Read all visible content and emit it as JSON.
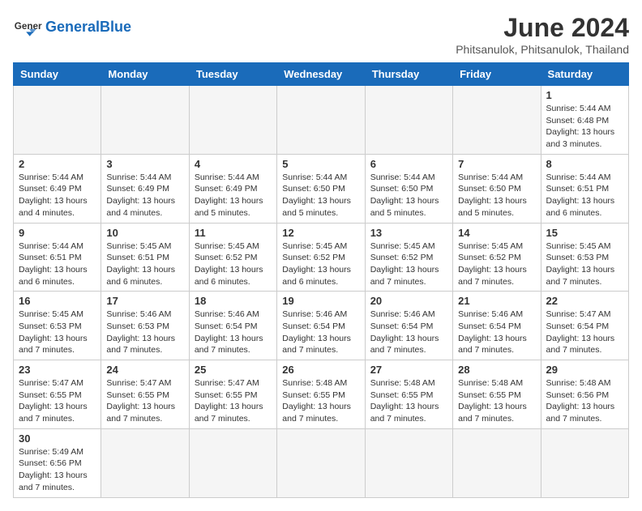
{
  "header": {
    "logo_general": "General",
    "logo_blue": "Blue",
    "month_title": "June 2024",
    "subtitle": "Phitsanulok, Phitsanulok, Thailand"
  },
  "days_of_week": [
    "Sunday",
    "Monday",
    "Tuesday",
    "Wednesday",
    "Thursday",
    "Friday",
    "Saturday"
  ],
  "weeks": [
    [
      {
        "day": "",
        "info": ""
      },
      {
        "day": "",
        "info": ""
      },
      {
        "day": "",
        "info": ""
      },
      {
        "day": "",
        "info": ""
      },
      {
        "day": "",
        "info": ""
      },
      {
        "day": "",
        "info": ""
      },
      {
        "day": "1",
        "info": "Sunrise: 5:44 AM\nSunset: 6:48 PM\nDaylight: 13 hours and 3 minutes."
      }
    ],
    [
      {
        "day": "2",
        "info": "Sunrise: 5:44 AM\nSunset: 6:49 PM\nDaylight: 13 hours and 4 minutes."
      },
      {
        "day": "3",
        "info": "Sunrise: 5:44 AM\nSunset: 6:49 PM\nDaylight: 13 hours and 4 minutes."
      },
      {
        "day": "4",
        "info": "Sunrise: 5:44 AM\nSunset: 6:49 PM\nDaylight: 13 hours and 5 minutes."
      },
      {
        "day": "5",
        "info": "Sunrise: 5:44 AM\nSunset: 6:50 PM\nDaylight: 13 hours and 5 minutes."
      },
      {
        "day": "6",
        "info": "Sunrise: 5:44 AM\nSunset: 6:50 PM\nDaylight: 13 hours and 5 minutes."
      },
      {
        "day": "7",
        "info": "Sunrise: 5:44 AM\nSunset: 6:50 PM\nDaylight: 13 hours and 5 minutes."
      },
      {
        "day": "8",
        "info": "Sunrise: 5:44 AM\nSunset: 6:51 PM\nDaylight: 13 hours and 6 minutes."
      }
    ],
    [
      {
        "day": "9",
        "info": "Sunrise: 5:44 AM\nSunset: 6:51 PM\nDaylight: 13 hours and 6 minutes."
      },
      {
        "day": "10",
        "info": "Sunrise: 5:45 AM\nSunset: 6:51 PM\nDaylight: 13 hours and 6 minutes."
      },
      {
        "day": "11",
        "info": "Sunrise: 5:45 AM\nSunset: 6:52 PM\nDaylight: 13 hours and 6 minutes."
      },
      {
        "day": "12",
        "info": "Sunrise: 5:45 AM\nSunset: 6:52 PM\nDaylight: 13 hours and 6 minutes."
      },
      {
        "day": "13",
        "info": "Sunrise: 5:45 AM\nSunset: 6:52 PM\nDaylight: 13 hours and 7 minutes."
      },
      {
        "day": "14",
        "info": "Sunrise: 5:45 AM\nSunset: 6:52 PM\nDaylight: 13 hours and 7 minutes."
      },
      {
        "day": "15",
        "info": "Sunrise: 5:45 AM\nSunset: 6:53 PM\nDaylight: 13 hours and 7 minutes."
      }
    ],
    [
      {
        "day": "16",
        "info": "Sunrise: 5:45 AM\nSunset: 6:53 PM\nDaylight: 13 hours and 7 minutes."
      },
      {
        "day": "17",
        "info": "Sunrise: 5:46 AM\nSunset: 6:53 PM\nDaylight: 13 hours and 7 minutes."
      },
      {
        "day": "18",
        "info": "Sunrise: 5:46 AM\nSunset: 6:54 PM\nDaylight: 13 hours and 7 minutes."
      },
      {
        "day": "19",
        "info": "Sunrise: 5:46 AM\nSunset: 6:54 PM\nDaylight: 13 hours and 7 minutes."
      },
      {
        "day": "20",
        "info": "Sunrise: 5:46 AM\nSunset: 6:54 PM\nDaylight: 13 hours and 7 minutes."
      },
      {
        "day": "21",
        "info": "Sunrise: 5:46 AM\nSunset: 6:54 PM\nDaylight: 13 hours and 7 minutes."
      },
      {
        "day": "22",
        "info": "Sunrise: 5:47 AM\nSunset: 6:54 PM\nDaylight: 13 hours and 7 minutes."
      }
    ],
    [
      {
        "day": "23",
        "info": "Sunrise: 5:47 AM\nSunset: 6:55 PM\nDaylight: 13 hours and 7 minutes."
      },
      {
        "day": "24",
        "info": "Sunrise: 5:47 AM\nSunset: 6:55 PM\nDaylight: 13 hours and 7 minutes."
      },
      {
        "day": "25",
        "info": "Sunrise: 5:47 AM\nSunset: 6:55 PM\nDaylight: 13 hours and 7 minutes."
      },
      {
        "day": "26",
        "info": "Sunrise: 5:48 AM\nSunset: 6:55 PM\nDaylight: 13 hours and 7 minutes."
      },
      {
        "day": "27",
        "info": "Sunrise: 5:48 AM\nSunset: 6:55 PM\nDaylight: 13 hours and 7 minutes."
      },
      {
        "day": "28",
        "info": "Sunrise: 5:48 AM\nSunset: 6:55 PM\nDaylight: 13 hours and 7 minutes."
      },
      {
        "day": "29",
        "info": "Sunrise: 5:48 AM\nSunset: 6:56 PM\nDaylight: 13 hours and 7 minutes."
      }
    ],
    [
      {
        "day": "30",
        "info": "Sunrise: 5:49 AM\nSunset: 6:56 PM\nDaylight: 13 hours and 7 minutes."
      },
      {
        "day": "",
        "info": ""
      },
      {
        "day": "",
        "info": ""
      },
      {
        "day": "",
        "info": ""
      },
      {
        "day": "",
        "info": ""
      },
      {
        "day": "",
        "info": ""
      },
      {
        "day": "",
        "info": ""
      }
    ]
  ]
}
